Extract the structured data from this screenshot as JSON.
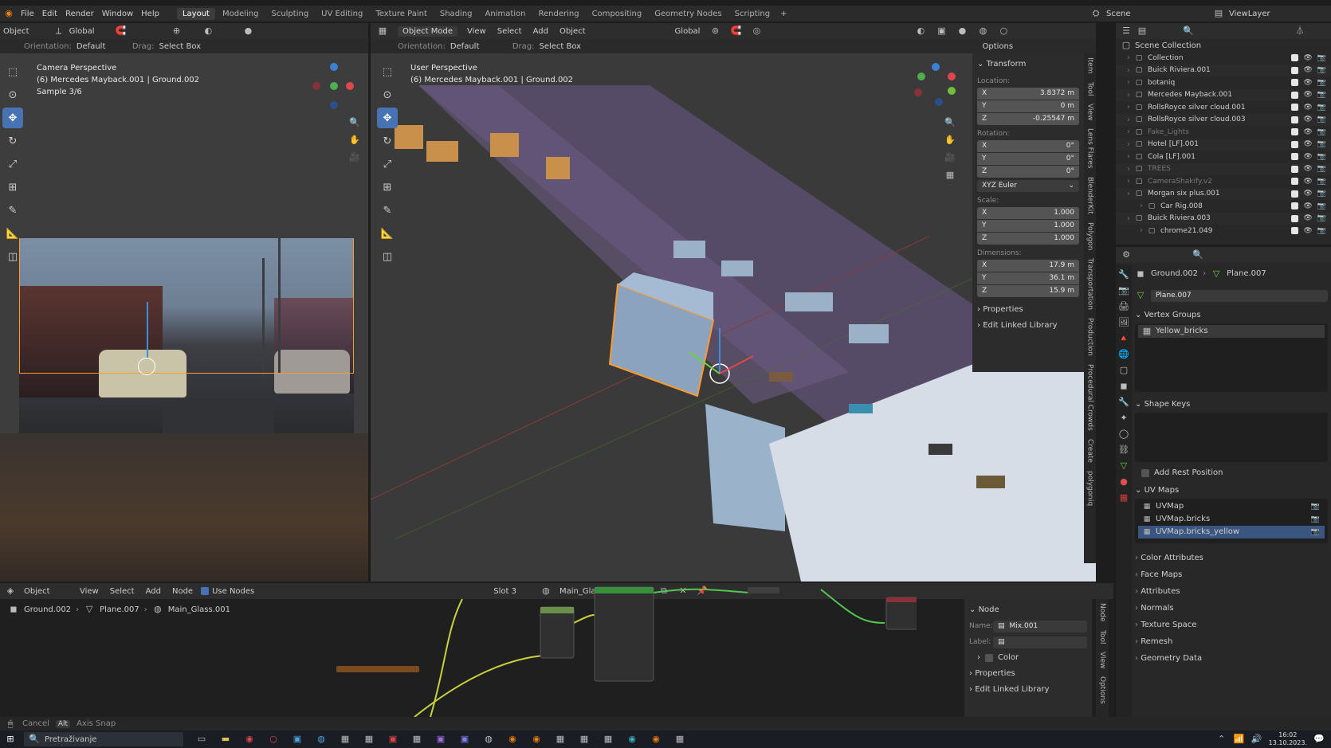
{
  "topmenu": {
    "menus": [
      "File",
      "Edit",
      "Render",
      "Window",
      "Help"
    ],
    "workspaces": [
      "Layout",
      "Modeling",
      "Sculpting",
      "UV Editing",
      "Texture Paint",
      "Shading",
      "Animation",
      "Rendering",
      "Compositing",
      "Geometry Nodes",
      "Scripting"
    ],
    "add": "+",
    "scene": "Scene",
    "viewlayer": "ViewLayer"
  },
  "left_vp": {
    "mode": "Object",
    "orientation_label": "Orientation:",
    "orientation": "Default",
    "transform": "Global",
    "drag_label": "Drag:",
    "drag": "Select Box",
    "title": "Camera Perspective",
    "subtitle": "(6) Mercedes Mayback.001 | Ground.002",
    "sample": "Sample 3/6"
  },
  "main_vp": {
    "mode": "Object Mode",
    "menus": [
      "View",
      "Select",
      "Add",
      "Object"
    ],
    "transform": "Global",
    "orientation_label": "Orientation:",
    "orientation": "Default",
    "drag_label": "Drag:",
    "drag": "Select Box",
    "options": "Options",
    "title": "User Perspective",
    "subtitle": "(6) Mercedes Mayback.001 | Ground.002"
  },
  "npanel": {
    "header": "Transform",
    "location_label": "Location:",
    "location": [
      "3.8372 m",
      "0 m",
      "-0.25547 m"
    ],
    "rotation_label": "Rotation:",
    "rotation": [
      "0°",
      "0°",
      "0°"
    ],
    "rot_mode": "XYZ Euler",
    "scale_label": "Scale:",
    "scale": [
      "1.000",
      "1.000",
      "1.000"
    ],
    "dimensions_label": "Dimensions:",
    "dimensions": [
      "17.9 m",
      "36.1 m",
      "15.9 m"
    ],
    "axes": [
      "X",
      "Y",
      "Z"
    ],
    "properties": "Properties",
    "linked": "Edit Linked Library",
    "tabs": [
      "Item",
      "Tool",
      "View",
      "Lens Flares",
      "BlenderKit",
      "Polygon",
      "Transportation",
      "Production",
      "Procedural Crowds",
      "Create",
      "polygoniq"
    ]
  },
  "outliner": {
    "root": "Scene Collection",
    "items": [
      "Collection",
      "Buick Riviera.001",
      "botaniq",
      "Mercedes Mayback.001",
      "RollsRoyce silver cloud.001",
      "RollsRoyce silver cloud.003",
      "Fake_Lights",
      "Hotel [LF].001",
      "Cola [LF].001",
      "TREES",
      "CameraShakify.v2",
      "Morgan six plus.001",
      "Car Rig.008",
      "Buick Riviera.003",
      "chrome21.049"
    ]
  },
  "props": {
    "object": "Ground.002",
    "mesh": "Plane.007",
    "data_name": "Plane.007",
    "vertex_groups": "Vertex Groups",
    "vg_item": "Yellow_bricks",
    "shape_keys": "Shape Keys",
    "add_rest": "Add Rest Position",
    "uv_maps": "UV Maps",
    "uv_items": [
      "UVMap",
      "UVMap.bricks",
      "UVMap.bricks_yellow"
    ],
    "sections": [
      "Color Attributes",
      "Face Maps",
      "Attributes",
      "Normals",
      "Texture Space",
      "Remesh",
      "Geometry Data"
    ]
  },
  "node_editor": {
    "mode": "Object",
    "menus": [
      "View",
      "Select",
      "Add",
      "Node"
    ],
    "use_nodes": "Use Nodes",
    "slot": "Slot 3",
    "material": "Main_Glass.001",
    "crumbs": [
      "Ground.002",
      "Plane.007",
      "Main_Glass.001"
    ],
    "panel_header": "Node",
    "name_label": "Name:",
    "name": "Mix.001",
    "label_label": "Label:",
    "color": "Color",
    "properties": "Properties",
    "linked": "Edit Linked Library",
    "tabs": [
      "Node",
      "Tool",
      "View",
      "Options"
    ]
  },
  "status": {
    "cancel": "Cancel",
    "axis_snap": "Axis Snap",
    "alt": "Alt"
  },
  "taskbar": {
    "search": "Pretraživanje",
    "time": "16:02",
    "date": "13.10.2023."
  }
}
